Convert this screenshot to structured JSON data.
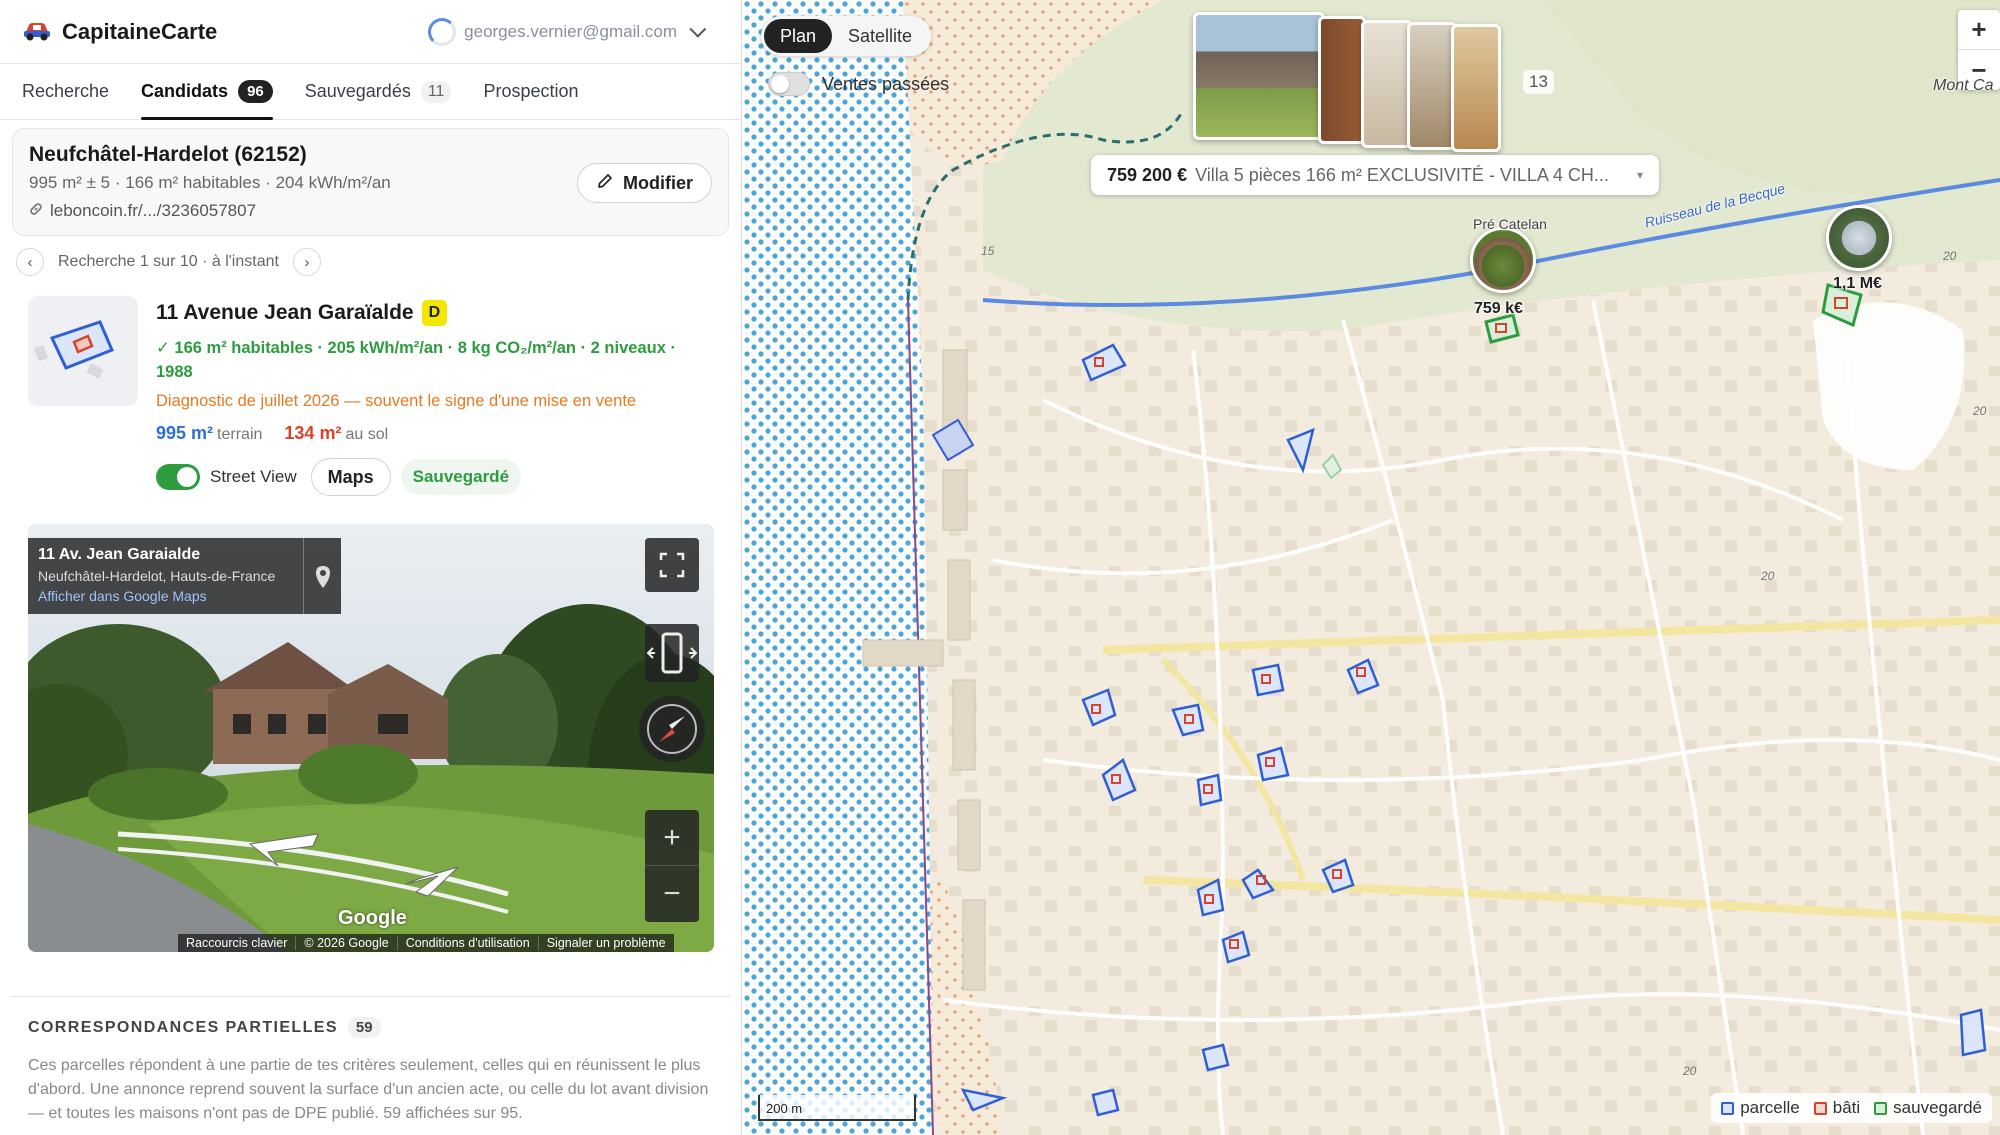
{
  "app": {
    "name": "CapitaineCarte",
    "account_email": "georges.vernier@gmail.com"
  },
  "tabs": [
    {
      "label": "Recherche",
      "count": ""
    },
    {
      "label": "Candidats",
      "count": "96"
    },
    {
      "label": "Sauvegardés",
      "count": "11"
    },
    {
      "label": "Prospection",
      "count": ""
    }
  ],
  "search": {
    "title": "Neufchâtel-Hardelot (62152)",
    "subtitle": "995 m² ± 5 · 166 m² habitables · 204 kWh/m²/an",
    "link": "leboncoin.fr/.../3236057807",
    "modify_label": "Modifier",
    "pager_text": "Recherche 1 sur 10 · à l'instant"
  },
  "result": {
    "address": "11 Avenue Jean Garaïalde",
    "dpe": "D",
    "metrics": "✓ 166 m² habitables · 205 kWh/m²/an · 8 kg CO₂/m²/an · 2 niveaux · 1988",
    "diagnostic": "Diagnostic de juillet 2026 — souvent le signe d'une mise en vente",
    "terrain_value": "995 m²",
    "terrain_label": "terrain",
    "sol_value": "134 m²",
    "sol_label": "au sol",
    "street_view_label": "Street View",
    "maps_label": "Maps",
    "saved_label": "Sauvegardé"
  },
  "streetview": {
    "title": "11 Av. Jean Garaialde",
    "subtitle": "Neufchâtel-Hardelot, Hauts-de-France",
    "open_link": "Afficher dans Google Maps",
    "google": "Google",
    "footer": [
      "Raccourcis clavier",
      "© 2026 Google",
      "Conditions d'utilisation",
      "Signaler un problème"
    ]
  },
  "partial": {
    "title": "CORRESPONDANCES PARTIELLES",
    "count": "59",
    "text": "Ces parcelles répondent à une partie de tes critères seulement, celles qui en réunissent le plus d'abord. Une annonce reprend souvent la surface d'un ancien acte, ou celle du lot avant division — et toutes les maisons n'ont pas de DPE publié. 59 affichées sur 95."
  },
  "map": {
    "mode_plan": "Plan",
    "mode_satellite": "Satellite",
    "past_sales_label": "Ventes passées",
    "photo_count": "13",
    "listing_price": "759 200 €",
    "listing_desc": "Villa 5 pièces 166 m² EXCLUSIVITÉ - VILLA 4 CH...",
    "pin1_label": "759 k€",
    "pin2_label": "1,1 M€",
    "place_pre_catelan": "Pré Catelan",
    "place_mont": "Mont Ca",
    "river": "Ruisseau de la Becque",
    "scale": "200 m",
    "legend": {
      "parcelle": "parcelle",
      "bati": "bâti",
      "sauvegarde": "sauvegardé"
    },
    "colors": {
      "parcelle": "#2f5ed6",
      "bati": "#d8432a",
      "sauvegarde": "#2c9c3f",
      "sea": "#4aa6d8"
    }
  }
}
